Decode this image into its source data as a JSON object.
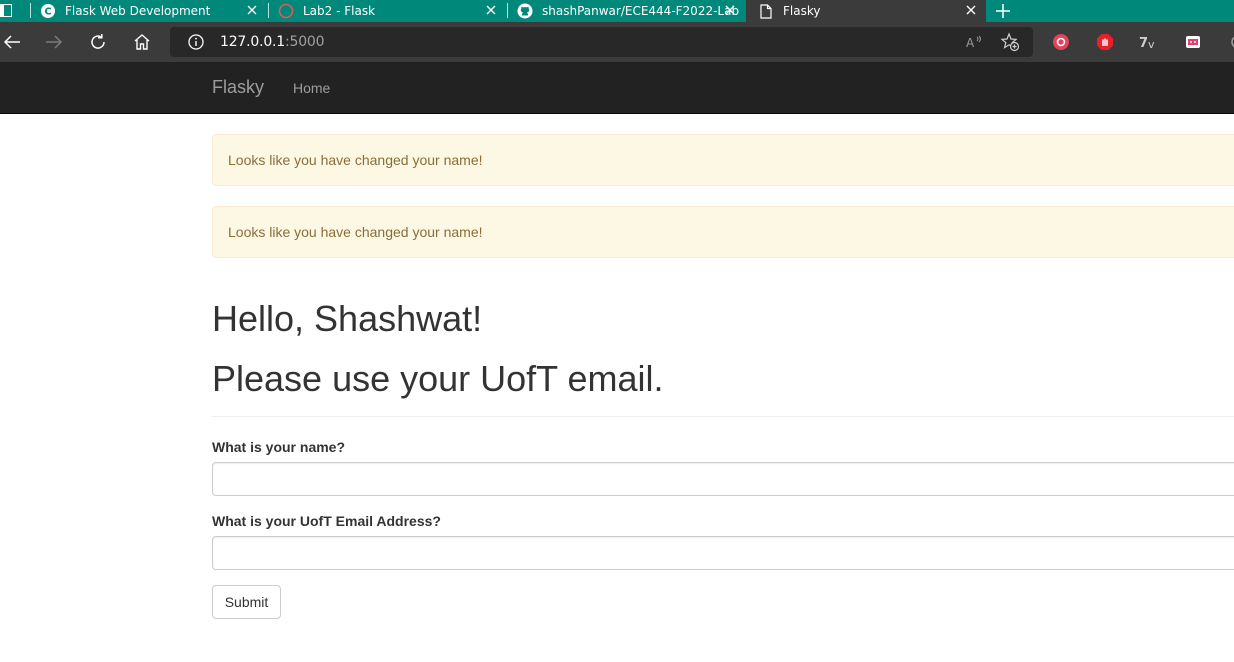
{
  "browser": {
    "tabs": [
      {
        "title": "Flask Web Development",
        "icon": "c-logo-icon",
        "active": false
      },
      {
        "title": "Lab2 - Flask",
        "icon": "loading-spinner-icon",
        "active": false
      },
      {
        "title": "shashPanwar/ECE444-F2022-Lab",
        "icon": "github-icon",
        "active": false
      },
      {
        "title": "Flasky",
        "icon": "page-icon",
        "active": true
      }
    ],
    "new_tab_icon": "plus-icon",
    "address": {
      "host": "127.0.0.1",
      "port": ":5000"
    },
    "colors": {
      "tab_strip": "#00897b",
      "toolbar": "#3b3b3b"
    }
  },
  "navbar": {
    "brand": "Flasky",
    "links": [
      "Home"
    ]
  },
  "alerts": [
    "Looks like you have changed your name!",
    "Looks like you have changed your name!"
  ],
  "headings": {
    "greeting": "Hello, Shashwat!",
    "notice": "Please use your UofT email."
  },
  "form": {
    "name_label": "What is your name?",
    "name_value": "",
    "email_label": "What is your UofT Email Address?",
    "email_value": "",
    "submit_label": "Submit"
  }
}
